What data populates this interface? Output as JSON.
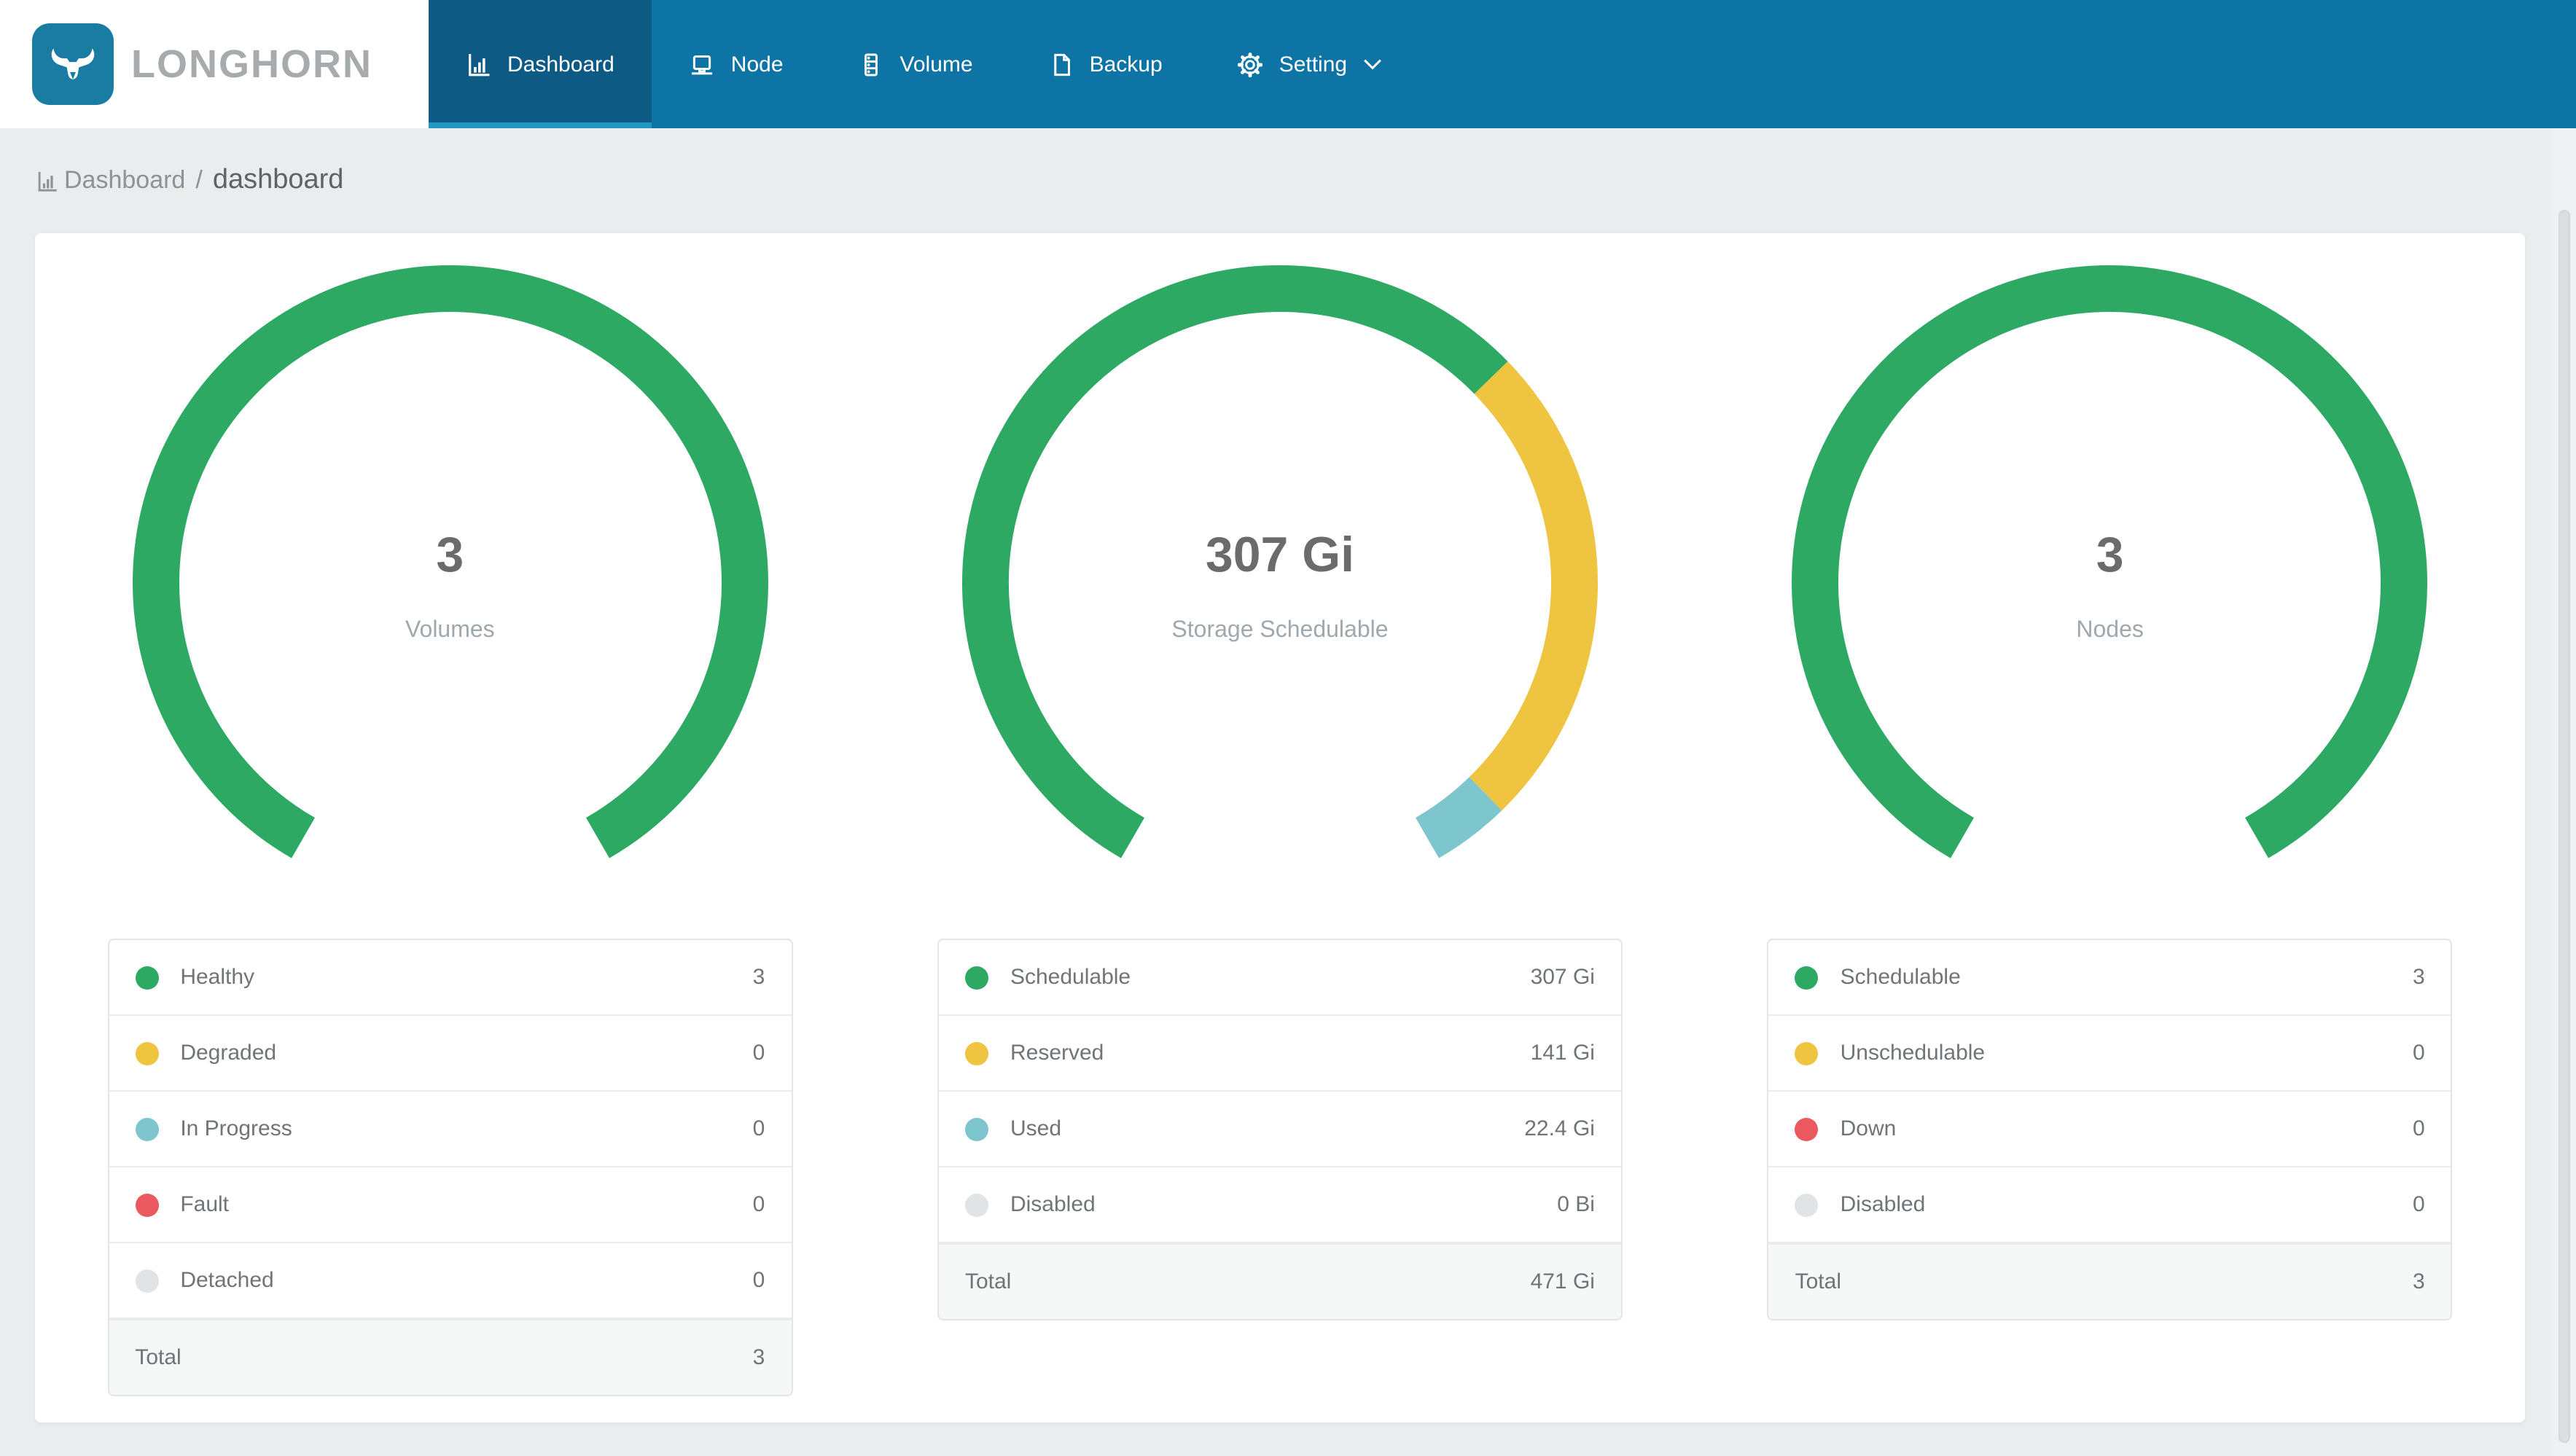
{
  "brand": {
    "name": "LONGHORN"
  },
  "nav": {
    "items": [
      {
        "label": "Dashboard",
        "active": true
      },
      {
        "label": "Node",
        "active": false
      },
      {
        "label": "Volume",
        "active": false
      },
      {
        "label": "Backup",
        "active": false
      },
      {
        "label": "Setting",
        "active": false,
        "has_dropdown": true
      }
    ]
  },
  "breadcrumb": {
    "section": "Dashboard",
    "separator": "/",
    "page": "dashboard"
  },
  "colors": {
    "green": "#2EA963",
    "yellow": "#EFC441",
    "teal": "#7EC6CD",
    "red": "#E9595F",
    "gray": "#E1E4E7",
    "navbar": "#0E74A6",
    "navbar_active": "#0D5A85",
    "navbar_active_underline": "#2496C2",
    "logo_blue": "#1B7CA3"
  },
  "chart_data": [
    {
      "type": "pie",
      "title": "Volumes",
      "center_value": "3",
      "categories": [
        "Healthy",
        "Degraded",
        "In Progress",
        "Fault",
        "Detached"
      ],
      "values": [
        3,
        0,
        0,
        0,
        0
      ],
      "total": 3
    },
    {
      "type": "pie",
      "title": "Storage Schedulable",
      "center_value": "307 Gi",
      "categories": [
        "Schedulable",
        "Reserved",
        "Used",
        "Disabled"
      ],
      "values": [
        307,
        141,
        22.4,
        0
      ],
      "total": 471,
      "unit": "Gi"
    },
    {
      "type": "pie",
      "title": "Nodes",
      "center_value": "3",
      "categories": [
        "Schedulable",
        "Unschedulable",
        "Down",
        "Disabled"
      ],
      "values": [
        3,
        0,
        0,
        0
      ],
      "total": 3
    }
  ],
  "gauges": [
    {
      "center_value": "3",
      "center_label": "Volumes",
      "segments": [
        {
          "color": "green",
          "value": 3
        }
      ],
      "legend": [
        {
          "label": "Healthy",
          "color": "green",
          "value": "3"
        },
        {
          "label": "Degraded",
          "color": "yellow",
          "value": "0"
        },
        {
          "label": "In Progress",
          "color": "teal",
          "value": "0"
        },
        {
          "label": "Fault",
          "color": "red",
          "value": "0"
        },
        {
          "label": "Detached",
          "color": "gray",
          "value": "0"
        }
      ],
      "total": {
        "label": "Total",
        "value": "3"
      }
    },
    {
      "center_value": "307 Gi",
      "center_label": "Storage Schedulable",
      "segments": [
        {
          "color": "green",
          "value": 307
        },
        {
          "color": "yellow",
          "value": 141
        },
        {
          "color": "teal",
          "value": 22.4
        }
      ],
      "legend": [
        {
          "label": "Schedulable",
          "color": "green",
          "value": "307 Gi"
        },
        {
          "label": "Reserved",
          "color": "yellow",
          "value": "141 Gi"
        },
        {
          "label": "Used",
          "color": "teal",
          "value": "22.4 Gi"
        },
        {
          "label": "Disabled",
          "color": "gray",
          "value": "0 Bi"
        }
      ],
      "total": {
        "label": "Total",
        "value": "471 Gi"
      }
    },
    {
      "center_value": "3",
      "center_label": "Nodes",
      "segments": [
        {
          "color": "green",
          "value": 3
        }
      ],
      "legend": [
        {
          "label": "Schedulable",
          "color": "green",
          "value": "3"
        },
        {
          "label": "Unschedulable",
          "color": "yellow",
          "value": "0"
        },
        {
          "label": "Down",
          "color": "red",
          "value": "0"
        },
        {
          "label": "Disabled",
          "color": "gray",
          "value": "0"
        }
      ],
      "total": {
        "label": "Total",
        "value": "3"
      }
    }
  ]
}
